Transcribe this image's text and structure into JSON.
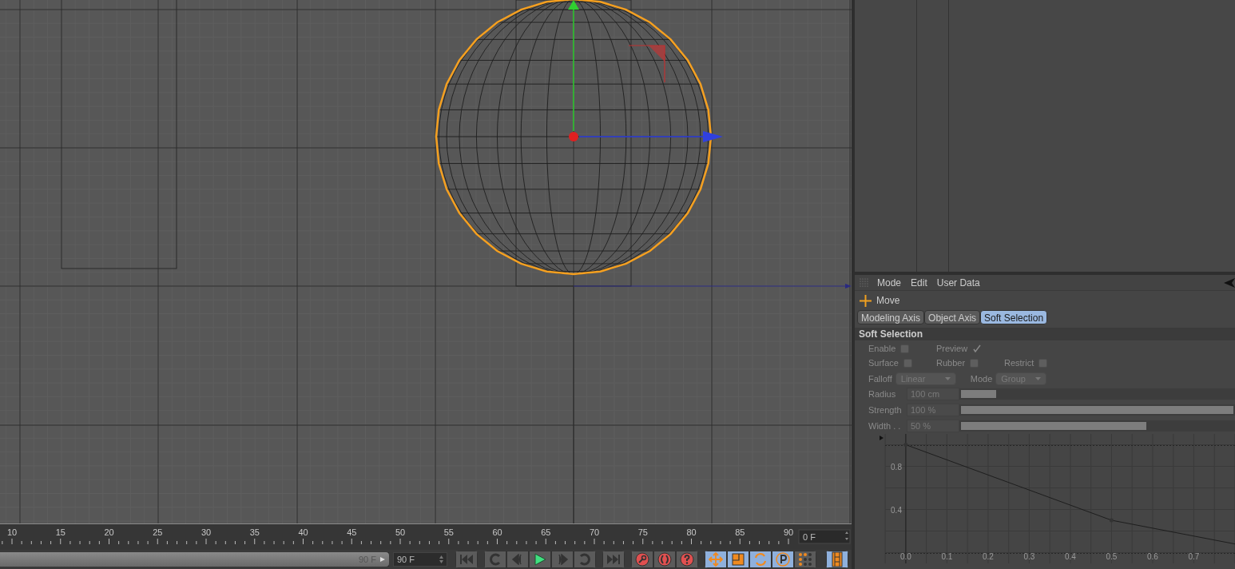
{
  "timeline": {
    "ruler_labels": [
      "10",
      "15",
      "20",
      "25",
      "30",
      "35",
      "40",
      "45",
      "50",
      "55",
      "60",
      "65",
      "70",
      "75",
      "80",
      "85",
      "90"
    ],
    "current_frame": "0 F",
    "range_end": "90 F",
    "end_frame": "90 F",
    "range_slider": {
      "level": 1
    }
  },
  "mode_buttons": [
    {
      "selected": true
    },
    {
      "selected": true
    },
    {
      "selected": true
    },
    {
      "selected": true
    },
    {
      "selected": false
    }
  ],
  "film_button": {
    "selected": true
  },
  "attributes": {
    "menu": [
      "Mode",
      "Edit",
      "User Data"
    ],
    "tool": "Move",
    "tabs": [
      {
        "label": "Modeling Axis",
        "selected": false
      },
      {
        "label": "Object Axis",
        "selected": false
      },
      {
        "label": "Soft Selection",
        "selected": true
      }
    ],
    "section": "Soft Selection",
    "checkbox_rows": [
      [
        {
          "label": "Enable",
          "checked": false
        },
        {
          "label": "Preview",
          "checked": true
        }
      ],
      [
        {
          "label": "Surface",
          "checked": false
        },
        {
          "label": "Rubber",
          "checked": false
        },
        {
          "label": "Restrict",
          "checked": false
        }
      ]
    ],
    "dropdowns": [
      {
        "label": "Falloff",
        "value": "Linear"
      },
      {
        "label": "Mode",
        "value": "Group"
      }
    ],
    "sliders": [
      {
        "label": "Radius",
        "value": "100 cm",
        "level": 0.13
      },
      {
        "label": "Strength",
        "value": "100 %",
        "level": 1
      },
      {
        "label": "Width . .",
        "value": "50 %",
        "level": 0.68
      }
    ],
    "chart_data": {
      "type": "line",
      "x": [
        0,
        0.5,
        0.8
      ],
      "values": [
        1,
        0.3,
        0.08
      ],
      "xlim": [
        -0.124,
        0.8
      ],
      "ylim": [
        -0.1,
        1.1
      ],
      "grid": true,
      "xticks": [
        {
          "value": 0,
          "label": "0.0"
        },
        {
          "value": 0.1,
          "label": "0.1"
        },
        {
          "value": 0.2,
          "label": "0.2"
        },
        {
          "value": 0.3,
          "label": "0.3"
        },
        {
          "value": 0.4,
          "label": "0.4"
        },
        {
          "value": 0.5,
          "label": "0.5"
        },
        {
          "value": 0.6,
          "label": "0.6"
        },
        {
          "value": 0.7,
          "label": "0.7"
        }
      ],
      "yticks": [
        {
          "value": 0.8,
          "label": "0.8"
        },
        {
          "value": 0.4,
          "label": "0.4"
        }
      ]
    }
  }
}
